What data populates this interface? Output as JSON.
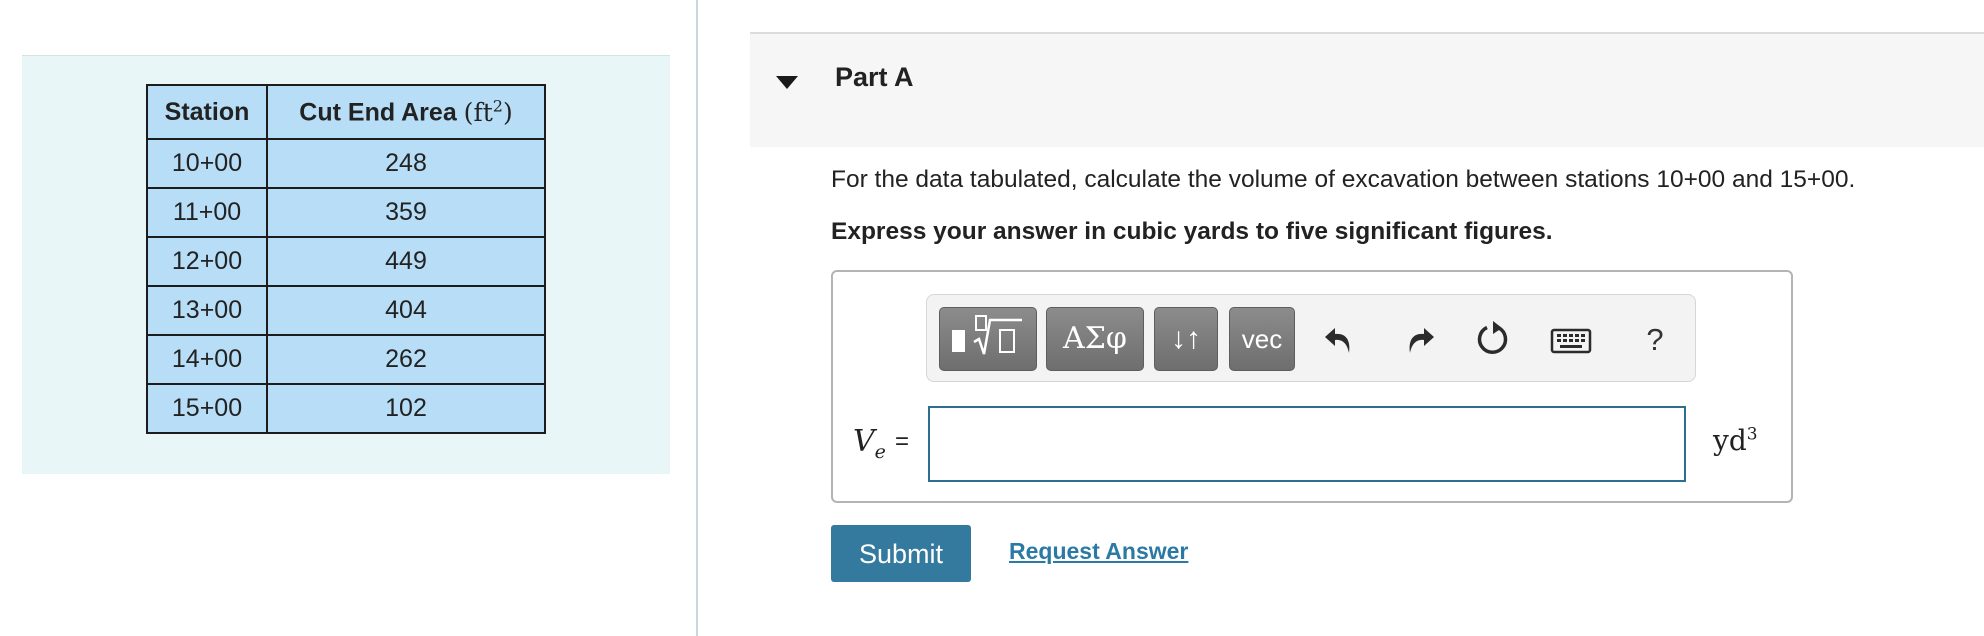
{
  "table": {
    "headers": {
      "station": "Station",
      "area_label": "Cut End Area",
      "area_unit_base": "ft",
      "area_unit_exp": "2"
    },
    "rows": [
      {
        "station": "10+00",
        "area": "248"
      },
      {
        "station": "11+00",
        "area": "359"
      },
      {
        "station": "12+00",
        "area": "449"
      },
      {
        "station": "13+00",
        "area": "404"
      },
      {
        "station": "14+00",
        "area": "262"
      },
      {
        "station": "15+00",
        "area": "102"
      }
    ]
  },
  "part": {
    "title": "Part A"
  },
  "question": "For the data tabulated, calculate the volume of excavation between stations 10+00 and 15+00.",
  "instruction": "Express your answer in cubic yards to five significant figures.",
  "toolbar": {
    "greek_label": "ΑΣφ",
    "arrows_label": "↓↑",
    "vec_label": "vec",
    "help_label": "?",
    "icons": [
      "templates-icon",
      "greek-symbols-icon",
      "subscript-superscript-icon",
      "vector-icon",
      "undo-icon",
      "redo-icon",
      "reset-icon",
      "keyboard-icon",
      "help-icon"
    ]
  },
  "answer": {
    "variable": "V",
    "subscript": "e",
    "equals": "=",
    "value": "",
    "unit_base": "yd",
    "unit_exp": "3"
  },
  "actions": {
    "submit_label": "Submit",
    "request_label": "Request Answer"
  },
  "colors": {
    "table_fill": "#b7def6",
    "panel_bg": "#e8f6f8",
    "submit_bg": "#347a9f",
    "link": "#2b7aa6",
    "input_border": "#2c6f8e"
  }
}
